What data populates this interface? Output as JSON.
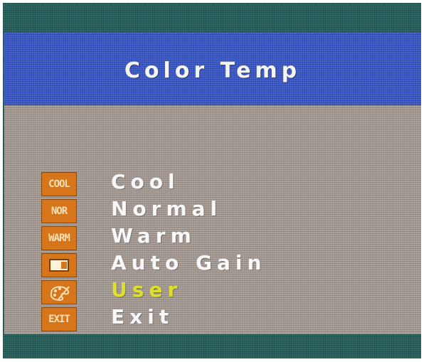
{
  "menu": {
    "title": "Color Temp",
    "items": [
      {
        "label": "Cool",
        "icon_text": "COOL",
        "icon": "cool-icon",
        "selected": false
      },
      {
        "label": "Normal",
        "icon_text": "NOR",
        "icon": "normal-icon",
        "selected": false
      },
      {
        "label": "Warm",
        "icon_text": "WARM",
        "icon": "warm-icon",
        "selected": false
      },
      {
        "label": "Auto Gain",
        "icon_text": "",
        "icon": "auto-gain-icon",
        "selected": false
      },
      {
        "label": "User",
        "icon_text": "",
        "icon": "palette-icon",
        "selected": true
      },
      {
        "label": "Exit",
        "icon_text": "EXIT",
        "icon": "exit-icon",
        "selected": false
      }
    ]
  },
  "colors": {
    "title_bar": "#3b58c8",
    "menu_body": "#a69c95",
    "icon_background": "#d7751b",
    "text": "#f8f8f8",
    "selected_text": "#dede2c",
    "frame": "#2f6a66"
  }
}
